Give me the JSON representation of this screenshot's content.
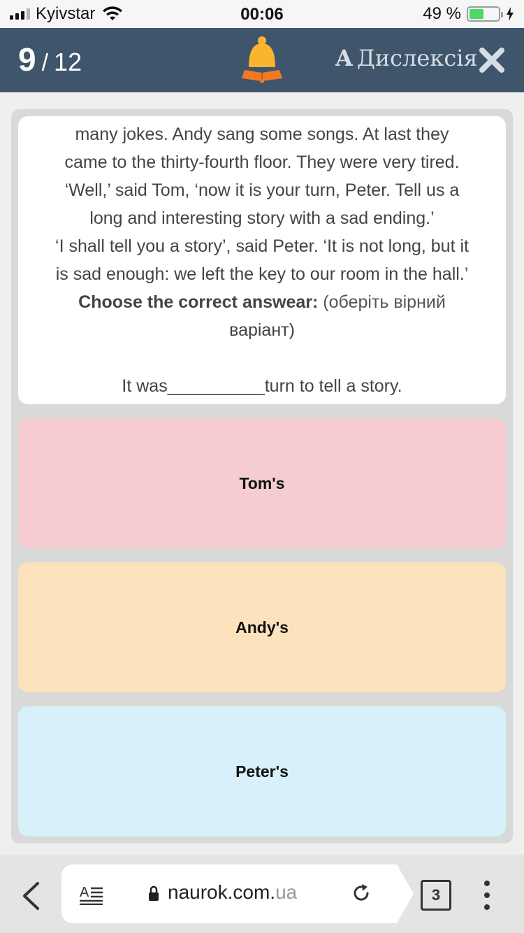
{
  "status_bar": {
    "carrier": "Kyivstar",
    "time": "00:06",
    "battery_percent": "49 %",
    "battery_level": 0.49
  },
  "header": {
    "question_current": "9",
    "separator": "/",
    "question_total": "12",
    "dyslexia_letter": "A",
    "dyslexia_label": "Дислексія",
    "icons": {
      "bell": "bell-book-icon",
      "close": "close-icon"
    },
    "colors": {
      "bar": "#3f556c",
      "bell": "#fbb42f"
    }
  },
  "question": {
    "lines": [
      "many jokes. Andy sang some songs. At last they",
      "came to the thirty-fourth floor. They were very tired.",
      "‘Well,’ said Tom, ‘now it is your turn, Peter. Tell us a",
      "long and interesting story with a sad ending.’",
      "‘I shall tell you a story’, said Peter. ‘It is not long, but it",
      "is sad enough: we left the key to our room in the hall.’"
    ],
    "instruction_bold": "Choose the correct answear:",
    "instruction_note_1": "(оберіть вірний",
    "instruction_note_2": "варіант)",
    "prompt": "It was__________turn to tell a story."
  },
  "answers": [
    {
      "label": "Tom's",
      "color": "#f5cdd0"
    },
    {
      "label": "Andy's",
      "color": "#fce3bd"
    },
    {
      "label": "Peter's",
      "color": "#d8f0fa"
    }
  ],
  "browser": {
    "url_domain": "naurok.com.",
    "url_tld": "ua",
    "tab_count": "3",
    "icons": {
      "back": "chevron-left-icon",
      "reader": "reader-mode-icon",
      "lock": "lock-icon",
      "reload": "reload-icon",
      "tabs": "tabs-icon",
      "more": "more-vertical-icon"
    }
  }
}
